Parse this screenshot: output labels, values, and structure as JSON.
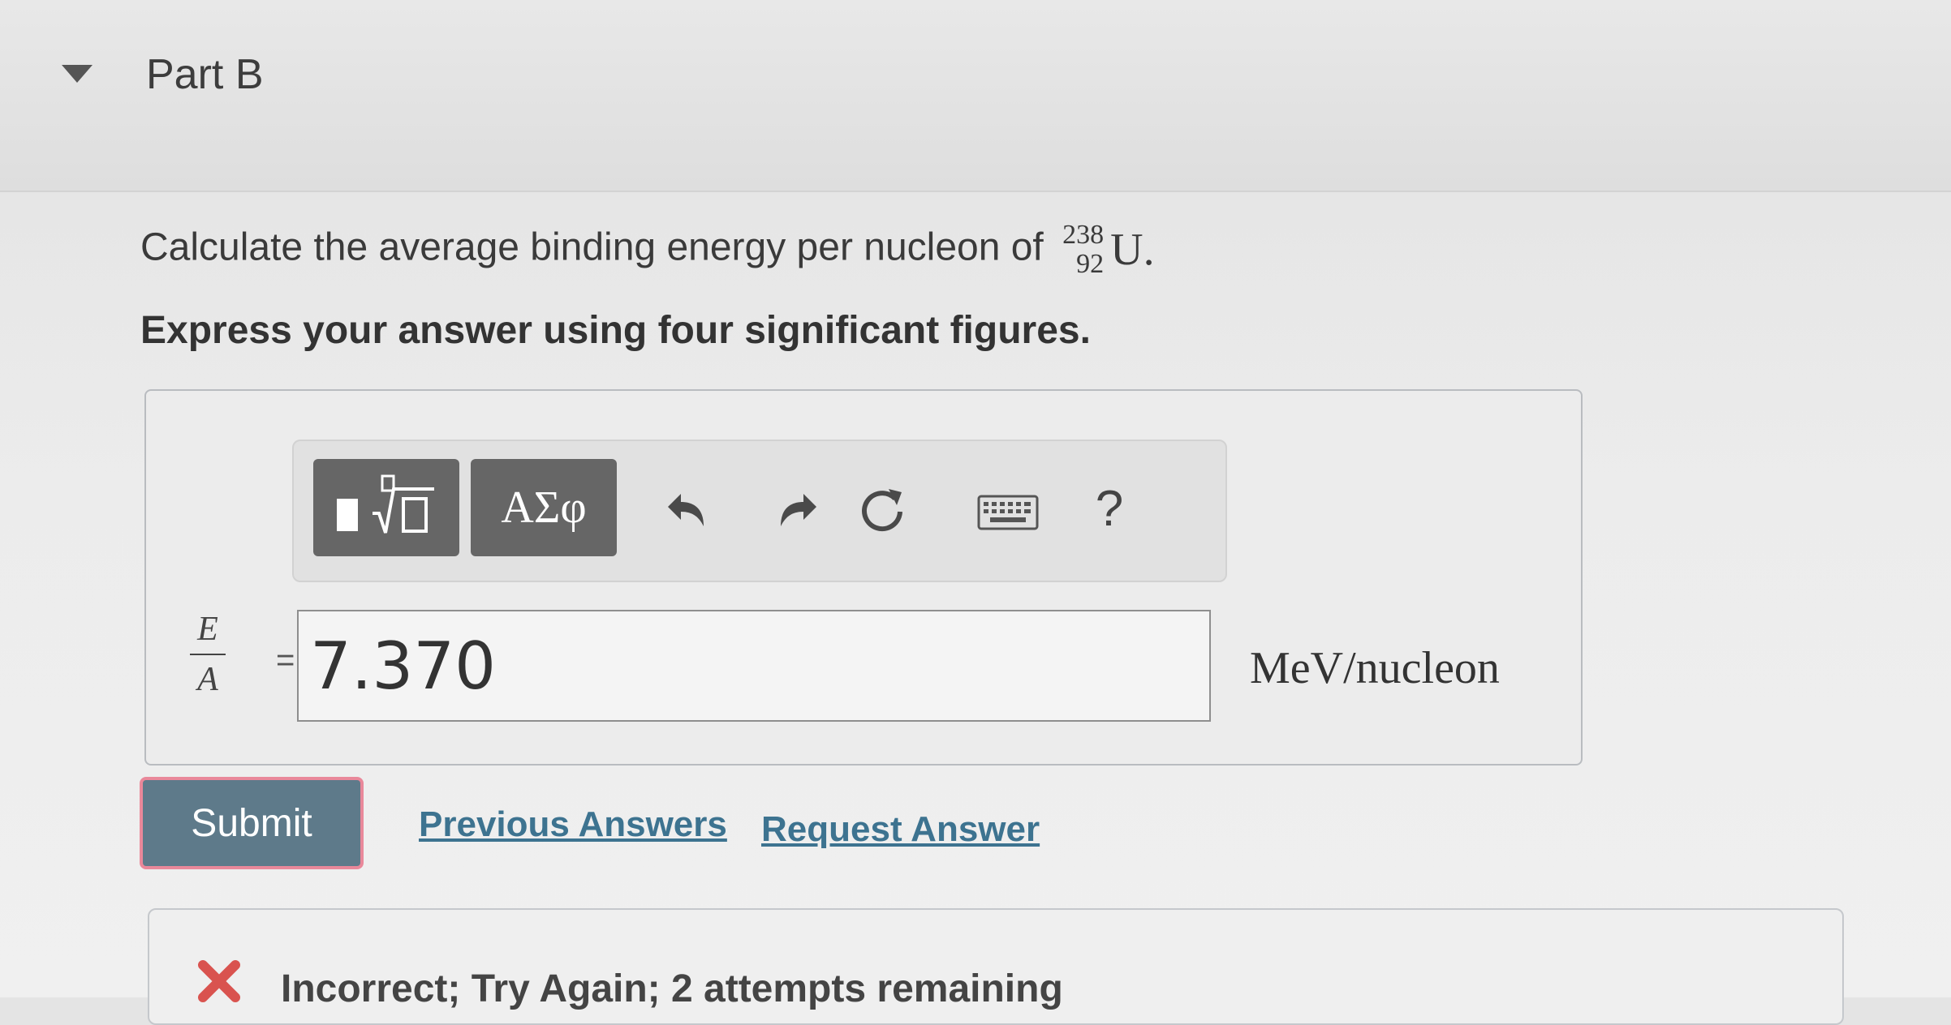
{
  "part": {
    "title": "Part B"
  },
  "question": {
    "text": "Calculate the average binding energy per nucleon of",
    "nuclide": {
      "mass_number": "238",
      "atomic_number": "92",
      "symbol": "U"
    },
    "end_punct": ".",
    "instructions": "Express your answer using four significant figures."
  },
  "toolbar": {
    "greek_label": "ΑΣφ",
    "help_label": "?"
  },
  "equation": {
    "numerator": "E",
    "denominator": "A",
    "equals": "="
  },
  "answer": {
    "value": "7.370",
    "units": "MeV/nucleon"
  },
  "actions": {
    "submit_label": "Submit",
    "previous_answers_label": "Previous Answers",
    "request_answer_label": "Request Answer"
  },
  "feedback": {
    "text": "Incorrect; Try Again; 2 attempts remaining"
  },
  "colors": {
    "submit_bg": "#5e7a8a",
    "submit_border": "#e9889a",
    "link": "#3d7390",
    "error": "#d9534f"
  }
}
